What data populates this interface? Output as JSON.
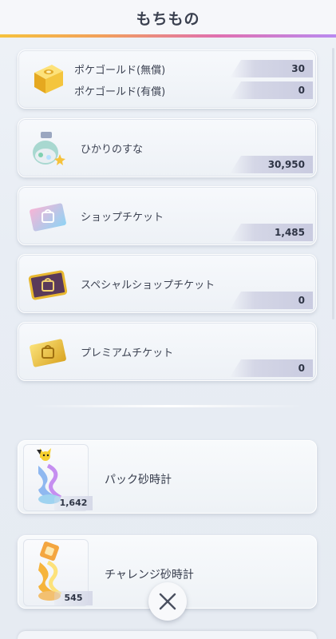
{
  "header": {
    "title": "もちもの"
  },
  "items": [
    {
      "name": "gold",
      "labels": [
        "ポケゴールド(無償)",
        "ポケゴールド(有償)"
      ],
      "values": [
        "30",
        "0"
      ],
      "icon": "gold-bar-icon"
    },
    {
      "name": "sand",
      "label": "ひかりのすな",
      "value": "30,950",
      "icon": "sand-bottle-icon"
    },
    {
      "name": "shop",
      "label": "ショップチケット",
      "value": "1,485",
      "icon": "shop-ticket-icon"
    },
    {
      "name": "special",
      "label": "スペシャルショップチケット",
      "value": "0",
      "icon": "special-shop-ticket-icon"
    },
    {
      "name": "premium",
      "label": "プレミアムチケット",
      "value": "0",
      "icon": "premium-ticket-icon"
    }
  ],
  "hourglasses": [
    {
      "label": "パック砂時計",
      "count": "1,642",
      "icon": "pack-hourglass-icon"
    },
    {
      "label": "チャレンジ砂時計",
      "count": "545",
      "icon": "challenge-hourglass-icon"
    }
  ],
  "close": {
    "icon": "close-icon"
  },
  "colors": {
    "accent_gradient": [
      "#f6c23c",
      "#e070b0",
      "#b98af0"
    ],
    "text": "#3b4150"
  }
}
